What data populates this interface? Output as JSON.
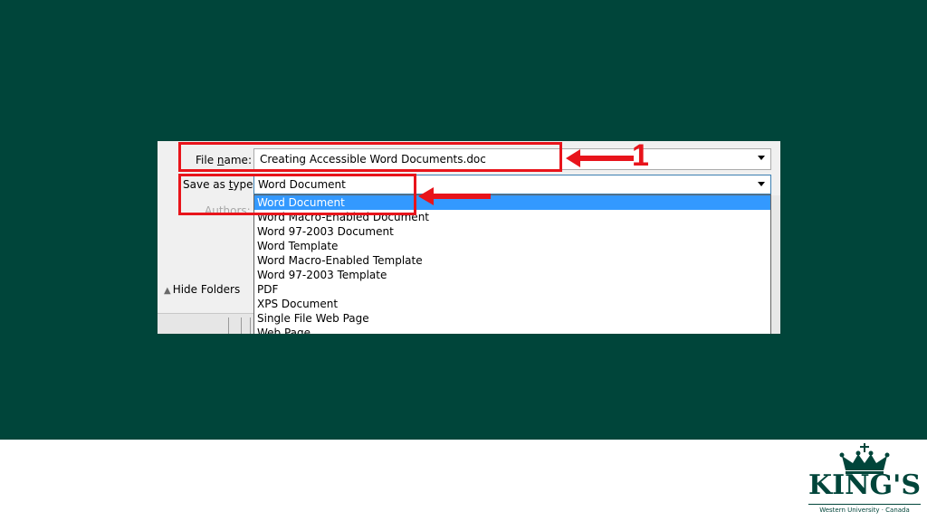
{
  "dialog": {
    "file_name_label": {
      "pre": "File ",
      "accel": "n",
      "post": "ame:"
    },
    "file_name_value": "Creating Accessible Word Documents.doc",
    "save_type_label": {
      "pre": "Save as ",
      "accel": "t",
      "post": "ype:"
    },
    "save_type_value": "Word Document",
    "authors_label": "Authors:",
    "hide_folders_label": "Hide Folders",
    "type_options": [
      "Word Document",
      "Word Macro-Enabled Document",
      "Word 97-2003 Document",
      "Word Template",
      "Word Macro-Enabled Template",
      "Word 97-2003 Template",
      "PDF",
      "XPS Document",
      "Single File Web Page",
      "Web Page"
    ],
    "selected_index": 0
  },
  "annotations": {
    "callout_number": "1",
    "color": "#e8141b"
  },
  "logo": {
    "name": "KING'S",
    "subtitle": "Western University · Canada",
    "color": "#00453a"
  },
  "theme": {
    "slide_background": "#00453a",
    "selection_color": "#3399ff"
  }
}
